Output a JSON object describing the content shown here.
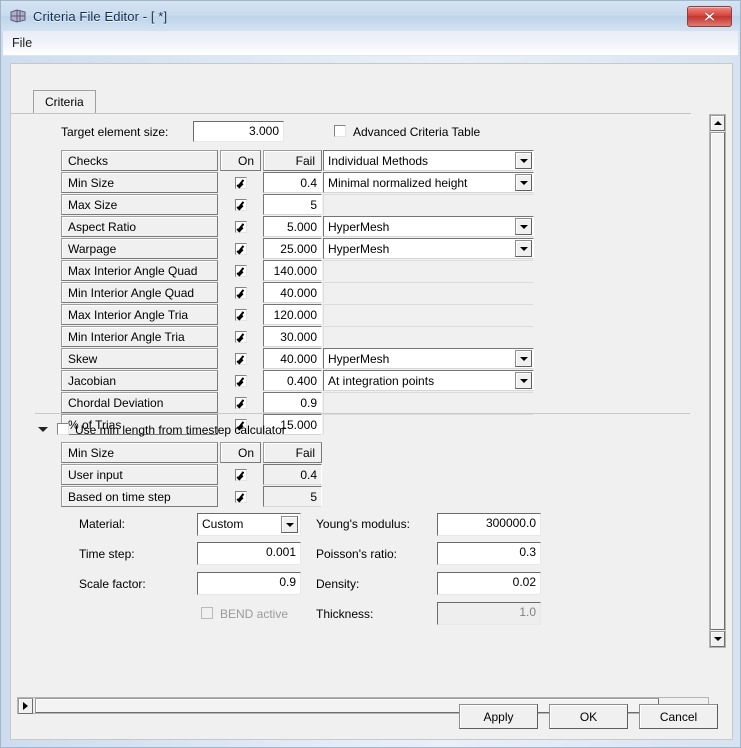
{
  "window": {
    "title": "Criteria File Editor - [ *]",
    "icon": "mesh-icon",
    "close_label": "x"
  },
  "menubar": {
    "items": [
      "File"
    ]
  },
  "tabs": [
    {
      "label": "Criteria",
      "active": true
    }
  ],
  "target": {
    "label": "Target element size:",
    "value": "3.000",
    "advanced_label": "Advanced Criteria Table",
    "advanced_checked": false
  },
  "criteria_table": {
    "headers": {
      "checks": "Checks",
      "on": "On",
      "fail": "Fail",
      "method": "Individual Methods"
    },
    "rows": [
      {
        "name": "Min Size",
        "on": true,
        "fail": "0.4",
        "method": "Minimal normalized height",
        "has_method": true
      },
      {
        "name": "Max Size",
        "on": true,
        "fail": "5",
        "method": "",
        "has_method": false
      },
      {
        "name": "Aspect Ratio",
        "on": true,
        "fail": "5.000",
        "method": "HyperMesh",
        "has_method": true
      },
      {
        "name": "Warpage",
        "on": true,
        "fail": "25.000",
        "method": "HyperMesh",
        "has_method": true
      },
      {
        "name": "Max Interior Angle Quad",
        "on": true,
        "fail": "140.000",
        "method": "",
        "has_method": false
      },
      {
        "name": "Min Interior Angle Quad",
        "on": true,
        "fail": "40.000",
        "method": "",
        "has_method": false
      },
      {
        "name": "Max Interior Angle Tria",
        "on": true,
        "fail": "120.000",
        "method": "",
        "has_method": false
      },
      {
        "name": "Min Interior Angle Tria",
        "on": true,
        "fail": "30.000",
        "method": "",
        "has_method": false
      },
      {
        "name": "Skew",
        "on": true,
        "fail": "40.000",
        "method": "HyperMesh",
        "has_method": true
      },
      {
        "name": "Jacobian",
        "on": true,
        "fail": "0.400",
        "method": "At integration points",
        "has_method": true
      },
      {
        "name": "Chordal Deviation",
        "on": true,
        "fail": "0.9",
        "method": "",
        "has_method": false
      },
      {
        "name": "% of Trias",
        "on": true,
        "fail": "15.000",
        "method": "",
        "has_method": false
      }
    ]
  },
  "timestep": {
    "checkbox_label": "Use min length from timestep calculator",
    "checkbox_checked": false,
    "headers": {
      "checks": "Min Size",
      "on": "On",
      "fail": "Fail"
    },
    "rows": [
      {
        "name": "User input",
        "on": true,
        "fail": "0.4"
      },
      {
        "name": "Based on time step",
        "on": true,
        "fail": "5"
      }
    ]
  },
  "material_form": {
    "material_label": "Material:",
    "material_value": "Custom",
    "time_step_label": "Time step:",
    "time_step_value": "0.001",
    "scale_factor_label": "Scale factor:",
    "scale_factor_value": "0.9",
    "bend_label": "BEND active",
    "bend_checked": false,
    "youngs_label": "Young's modulus:",
    "youngs_value": "300000.0",
    "poissons_label": "Poisson's ratio:",
    "poissons_value": "0.3",
    "density_label": "Density:",
    "density_value": "0.02",
    "thickness_label": "Thickness:",
    "thickness_value": "1.0"
  },
  "buttons": {
    "apply": "Apply",
    "ok": "OK",
    "cancel": "Cancel"
  }
}
